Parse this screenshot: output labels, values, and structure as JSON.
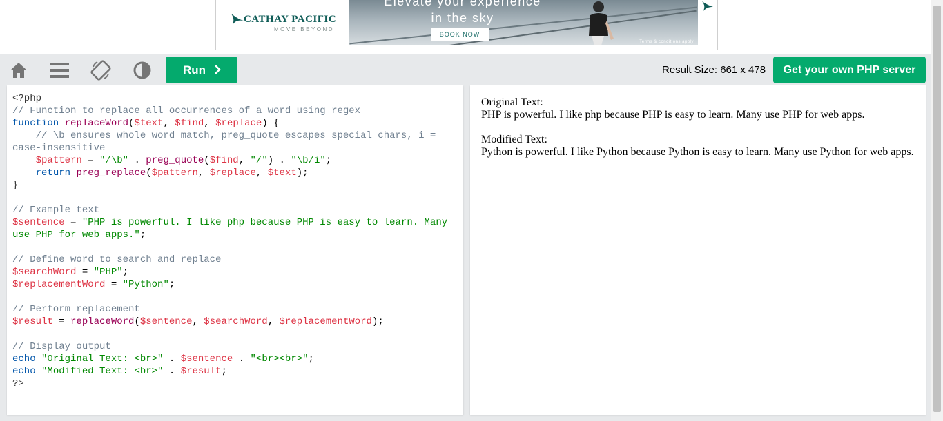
{
  "ad": {
    "brand_name": "CATHAY PACIFIC",
    "tagline": "MOVE BEYOND",
    "headline_line1": "Elevate your experience",
    "headline_line2": "in the sky",
    "cta_label": "BOOK NOW",
    "terms": "Terms & conditions apply",
    "brand_color": "#0f5c57"
  },
  "toolbar": {
    "home_icon": "home-icon",
    "menu_icon": "menu-icon",
    "rotate_icon": "rotate-icon",
    "contrast_icon": "contrast-icon",
    "run_label": "Run",
    "result_size": "Result Size: 661 x 478",
    "get_server_label": "Get your own PHP server",
    "accent_color": "#04aa6d"
  },
  "editor": {
    "lines": [
      "<?php",
      "// Function to replace all occurrences of a word using regex",
      "function replaceWord($text, $find, $replace) {",
      "    // \\b ensures whole word match, preg_quote escapes special chars, i =",
      "case-insensitive",
      "    $pattern = \"/\\b\" . preg_quote($find, \"/\") . \"\\b/i\";",
      "    return preg_replace($pattern, $replace, $text);",
      "}",
      "",
      "// Example text",
      "$sentence = \"PHP is powerful. I like php because PHP is easy to learn. Many",
      "use PHP for web apps.\";",
      "",
      "// Define word to search and replace",
      "$searchWord = \"PHP\";",
      "$replacementWord = \"Python\";",
      "",
      "// Perform replacement",
      "$result = replaceWord($sentence, $searchWord, $replacementWord);",
      "",
      "// Display output",
      "echo \"Original Text: <br>\" . $sentence . \"<br><br>\";",
      "echo \"Modified Text: <br>\" . $result;",
      "?>"
    ]
  },
  "result": {
    "original_label": "Original Text:",
    "original_text": "PHP is powerful. I like php because PHP is easy to learn. Many use PHP for web apps.",
    "modified_label": "Modified Text:",
    "modified_text": "Python is powerful. I like Python because Python is easy to learn. Many use Python for web apps."
  }
}
